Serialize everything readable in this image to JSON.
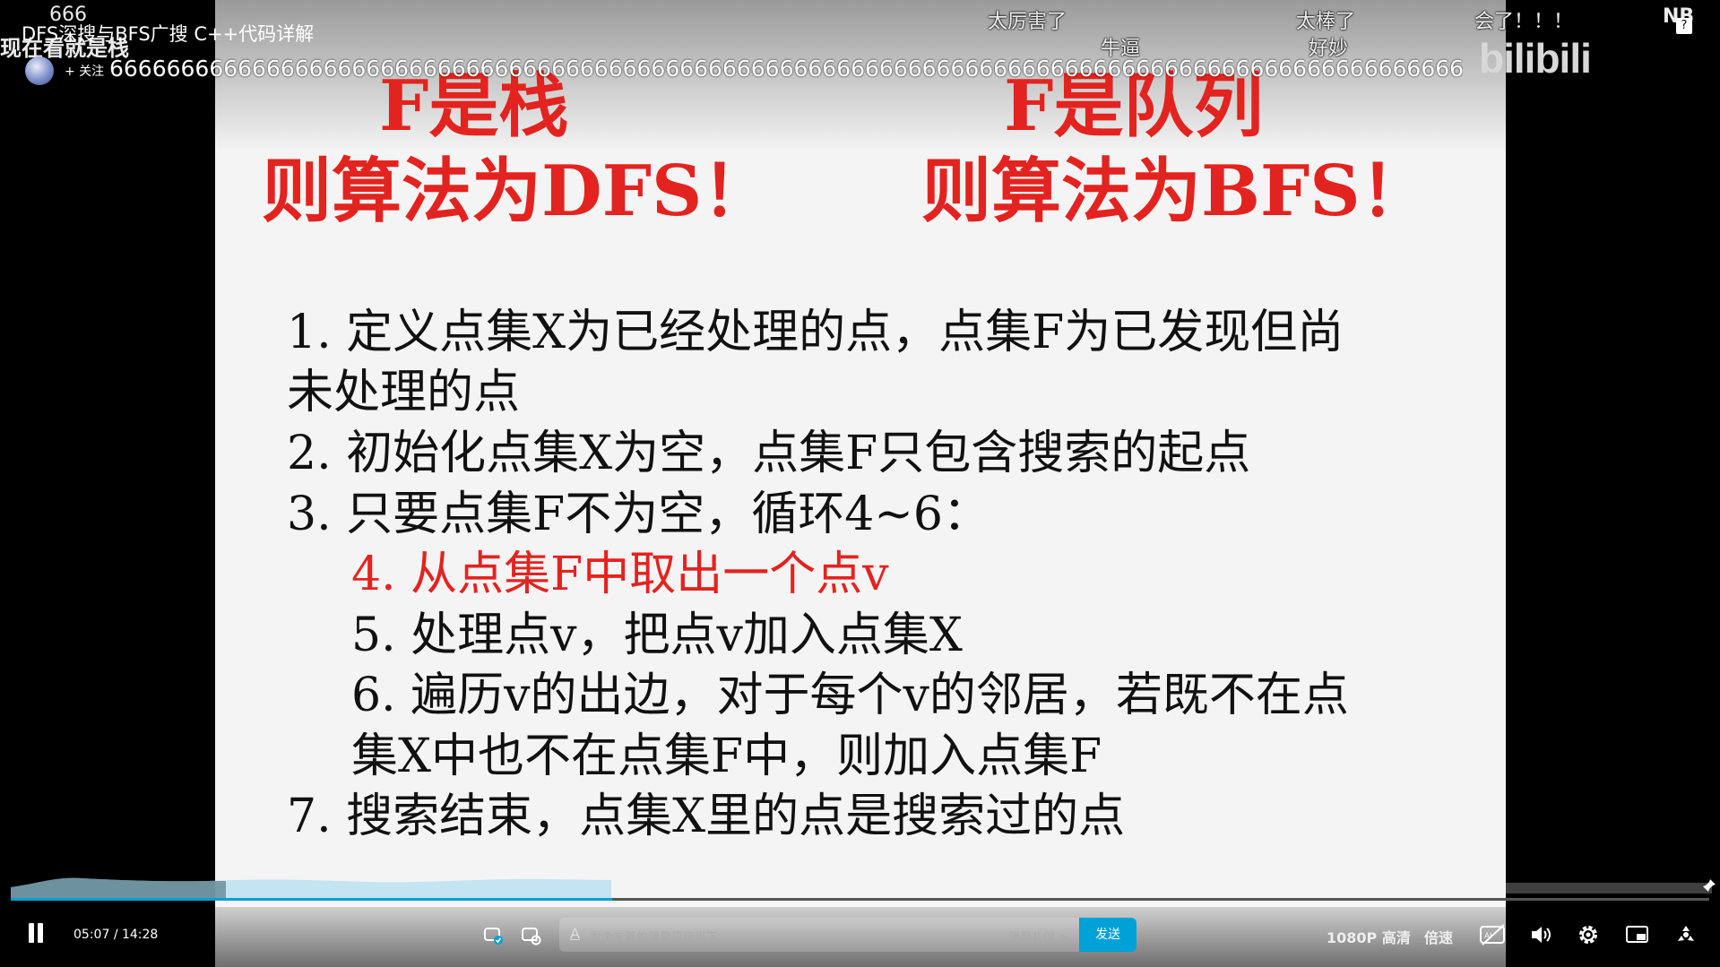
{
  "player": {
    "video_title": "DFS深搜与BFS广搜 C++代码详解",
    "follow_label": "+ 关注",
    "time_current": "05:07",
    "time_separator": "/",
    "time_total": "14:28",
    "progress_fraction": 0.354,
    "danmaku_placeholder": "发个友善的弹幕见证当下",
    "danmaku_etiquette": "弹幕礼仪 >",
    "send_label": "发送",
    "quality_label": "1080P 高清",
    "speed_label": "倍速",
    "logo_text": "bilibili",
    "help_glyph": "?",
    "accent": "#00a1d6"
  },
  "danmaku": [
    "666",
    "现在看就是栈",
    "太厉害了",
    "牛逼",
    "太棒了",
    "好妙",
    "会了！！！",
    "NB",
    "66666666666666666666666666666666666666666666666666666666666666666666666666666666666666666666666666"
  ],
  "slide": {
    "left_heading_line1": "F是栈",
    "left_heading_line2": "则算法为DFS！",
    "right_heading_line1": "F是队列",
    "right_heading_line2": "则算法为BFS！",
    "steps": [
      "1. 定义点集X为已经处理的点，点集F为已发现但尚",
      "未处理的点",
      "2. 初始化点集X为空，点集F只包含搜索的起点",
      "3. 只要点集F不为空，循环4~6：",
      "4. 从点集F中取出一个点v",
      "5. 处理点v，把点v加入点集X",
      "6. 遍历v的出边，对于每个v的邻居，若既不在点",
      "集X中也不在点集F中，则加入点集F",
      "7. 搜索结束，点集X里的点是搜索过的点"
    ],
    "highlight_color": "#e3231f"
  }
}
